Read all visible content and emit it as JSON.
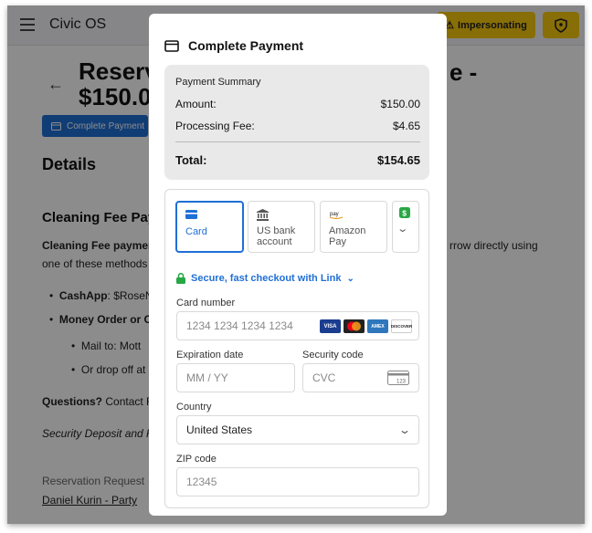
{
  "app": {
    "brand": "Civic OS",
    "impersonating_label": "Impersonating"
  },
  "page": {
    "title_part1": "Reserv",
    "title_part2": "$150.0",
    "title_suffix": "e -",
    "complete_payment_label": "Complete Payment",
    "details_heading": "Details",
    "cleaning_heading": "Cleaning Fee Payr",
    "cleaning_text_bold": "Cleaning Fee paymen",
    "cleaning_text_right": "rrow directly using",
    "cleaning_text_line2": "one of these methods",
    "bullet_cashapp_bold": "CashApp",
    "bullet_cashapp_rest": ": $RoseN",
    "bullet_money_order": "Money Order or C",
    "sub_mail": "Mail to: Mott",
    "sub_drop": "Or drop off at",
    "questions_bold": "Questions?",
    "questions_rest": " Contact R",
    "security_italic": "Security Deposit and F",
    "reservation_request": "Reservation Request",
    "reservation_link": "Daniel Kurin - Party"
  },
  "modal": {
    "title": "Complete Payment",
    "summary": {
      "title": "Payment Summary",
      "amount_label": "Amount:",
      "amount_value": "$150.00",
      "fee_label": "Processing Fee:",
      "fee_value": "$4.65",
      "total_label": "Total:",
      "total_value": "$154.65"
    },
    "tabs": [
      {
        "label": "Card",
        "icon": "card-icon"
      },
      {
        "label": "US bank account",
        "icon": "bank-icon"
      },
      {
        "label": "Amazon Pay",
        "icon": "amazon-pay-icon"
      },
      {
        "label": "",
        "icon": "cash-app-icon"
      }
    ],
    "link_checkout": "Secure, fast checkout with Link",
    "card_number_label": "Card number",
    "card_number_placeholder": "1234 1234 1234 1234",
    "expiration_label": "Expiration date",
    "expiration_placeholder": "MM / YY",
    "security_label": "Security code",
    "security_placeholder": "CVC",
    "cvc_icon_text": "123",
    "country_label": "Country",
    "country_value": "United States",
    "zip_label": "ZIP code",
    "zip_placeholder": "12345",
    "card_brands": [
      "VISA",
      "mastercard",
      "AMEX",
      "DISCOVER"
    ]
  },
  "colors": {
    "accent": "#1f6fd6",
    "warning": "#f8c90e",
    "link_green": "#28a745"
  }
}
